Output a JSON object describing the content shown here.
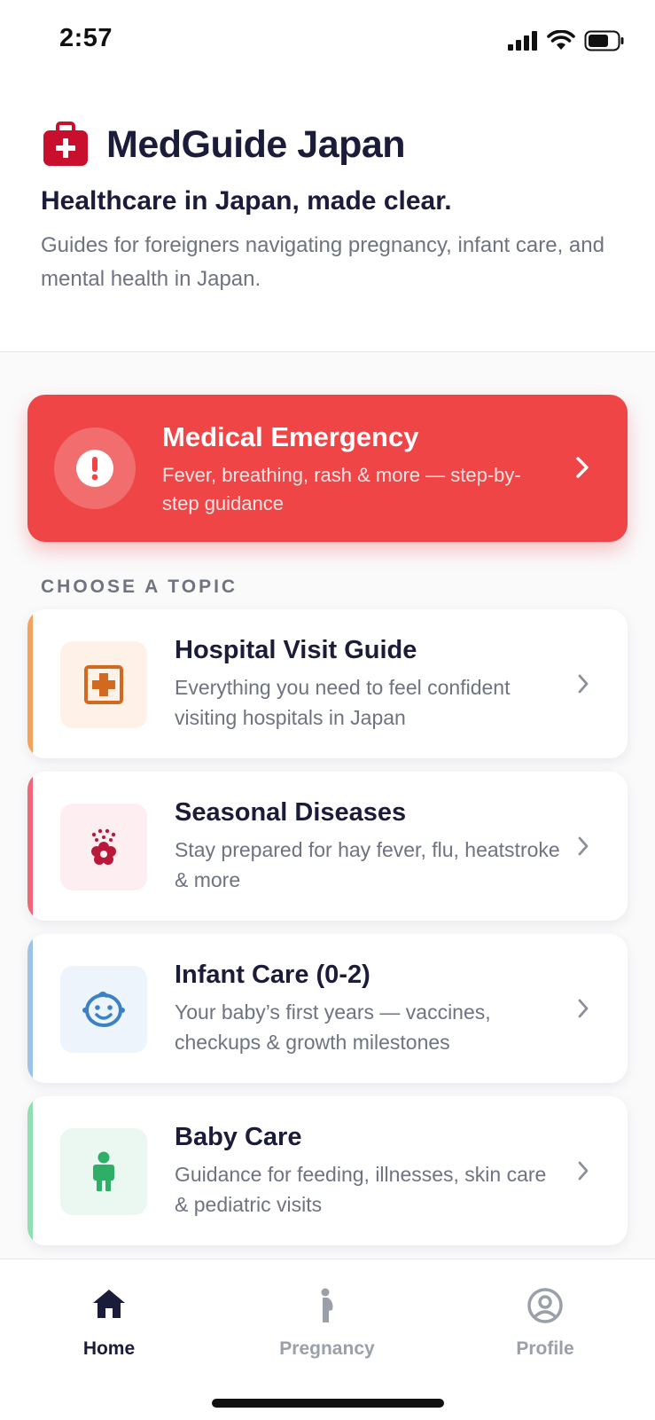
{
  "status_bar": {
    "time": "2:57"
  },
  "header": {
    "app_name": "MedGuide Japan",
    "tagline": "Healthcare in Japan, made clear.",
    "description": "Guides for foreigners navigating pregnancy, infant care, and mental health in Japan."
  },
  "emergency": {
    "title": "Medical Emergency",
    "subtitle": "Fever, breathing, rash & more — step-by-step guidance",
    "color": "#ef4546"
  },
  "section_label": "CHOOSE A TOPIC",
  "topics": [
    {
      "title": "Hospital Visit Guide",
      "description": "Everything you need to feel confident visiting hospitals in Japan",
      "icon": "hospital-icon",
      "accent": "#f5a25d"
    },
    {
      "title": "Seasonal Diseases",
      "description": "Stay prepared for hay fever, flu, heatstroke & more",
      "icon": "pollen-flower-icon",
      "accent": "#f2667a"
    },
    {
      "title": "Infant Care (0-2)",
      "description": "Your baby’s first years — vaccines, checkups & growth milestones",
      "icon": "baby-face-icon",
      "accent": "#9dc3e8"
    },
    {
      "title": "Baby Care",
      "description": "Guidance for feeding, illnesses, skin care & pediatric visits",
      "icon": "child-icon",
      "accent": "#8ee0b0"
    }
  ],
  "tab_bar": {
    "tabs": [
      {
        "label": "Home",
        "icon": "home-icon",
        "active": true
      },
      {
        "label": "Pregnancy",
        "icon": "pregnancy-icon",
        "active": false
      },
      {
        "label": "Profile",
        "icon": "profile-icon",
        "active": false
      }
    ]
  }
}
